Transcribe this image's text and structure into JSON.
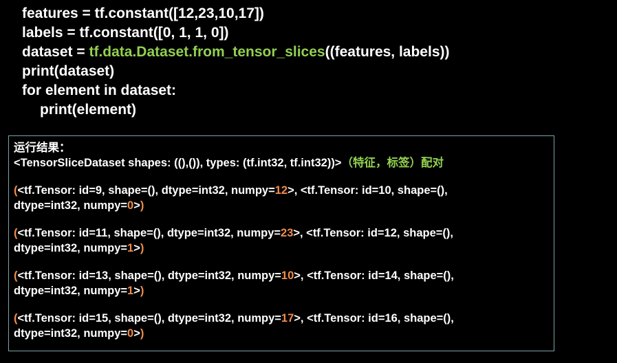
{
  "code": {
    "line1": "features = tf.constant([12,23,10,17])",
    "line2": "labels = tf.constant([0, 1, 1, 0])",
    "line3_prefix": "dataset = ",
    "line3_api": "tf.data.Dataset.from_tensor_slices",
    "line3_suffix": "((features, labels))",
    "line4": "print(dataset)",
    "line5": "for element in dataset:",
    "line6": "print(element)"
  },
  "result": {
    "heading": "运行结果：",
    "dataset_repr": "<TensorSliceDataset shapes: ((),()),  types: (tf.int32, tf.int32))>",
    "note": "（特征，标签）配对",
    "tuples": [
      {
        "open": "(",
        "a": "<tf.Tensor: id=9, shape=(), dtype=int32, numpy=",
        "a_val": "12",
        "b": ">, <tf.Tensor: id=10, shape=(),",
        "c": "dtype=int32, numpy=",
        "c_val": "0",
        "d": ">",
        "close": ")"
      },
      {
        "open": "(",
        "a": "<tf.Tensor: id=11, shape=(), dtype=int32, numpy=",
        "a_val": "23",
        "b": ">, <tf.Tensor: id=12, shape=(),",
        "c": "dtype=int32, numpy=",
        "c_val": "1",
        "d": ">",
        "close": ")"
      },
      {
        "open": "(",
        "a": "<tf.Tensor: id=13, shape=(), dtype=int32, numpy=",
        "a_val": "10",
        "b": ">, <tf.Tensor: id=14, shape=(),",
        "c": "dtype=int32, numpy=",
        "c_val": "1",
        "d": ">",
        "close": ")"
      },
      {
        "open": "(",
        "a": "<tf.Tensor: id=15, shape=(), dtype=int32, numpy=",
        "a_val": "17",
        "b": ">, <tf.Tensor: id=16, shape=(),",
        "c": "dtype=int32, numpy=",
        "c_val": "0",
        "d": ">",
        "close": ")"
      }
    ]
  },
  "colors": {
    "background": "#000000",
    "text": "#ffffff",
    "highlight_green": "#92d050",
    "highlight_orange": "#f08c4c",
    "box_border": "#7fa2a8"
  }
}
